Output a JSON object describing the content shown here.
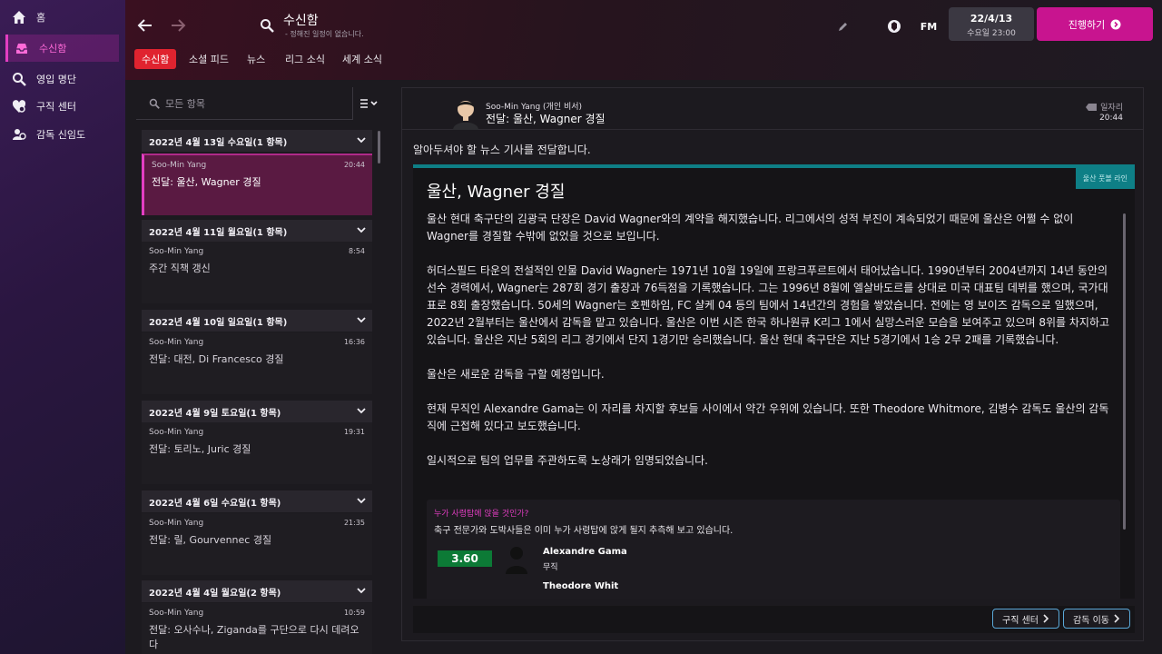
{
  "nav": {
    "items": [
      {
        "label": "홈",
        "icon": "home-icon"
      },
      {
        "label": "수신함",
        "icon": "inbox-icon",
        "active": true
      },
      {
        "label": "영입 명단",
        "icon": "search-icon"
      },
      {
        "label": "구직 센터",
        "icon": "job-centre-icon"
      },
      {
        "label": "감독 신임도",
        "icon": "manager-confidence-icon"
      }
    ]
  },
  "header": {
    "title": "수신함",
    "subtitle": "- 정해진 일정이 없습니다.",
    "date": "22/4/13",
    "date_sub": "수요일 23:00",
    "continue_label": "진행하기",
    "fm_label": "FM",
    "tabs": [
      "수신함",
      "소셜 피드",
      "뉴스",
      "리그 소식",
      "세계 소식"
    ]
  },
  "list": {
    "search_placeholder": "모든 항목",
    "groups": [
      {
        "header": "2022년 4월 13일 수요일(1 항목)",
        "sender": "Soo-Min Yang",
        "time": "20:44",
        "subject": "전달: 울산, Wagner 경질",
        "selected": true
      },
      {
        "header": "2022년 4월 11일 월요일(1 항목)",
        "sender": "Soo-Min Yang",
        "time": "8:54",
        "subject": "주간 직책 갱신"
      },
      {
        "header": "2022년 4월 10일 일요일(1 항목)",
        "sender": "Soo-Min Yang",
        "time": "16:36",
        "subject": "전달: 대전, Di Francesco 경질"
      },
      {
        "header": "2022년 4월 9일 토요일(1 항목)",
        "sender": "Soo-Min Yang",
        "time": "19:31",
        "subject": "전달: 토리노, Juric 경질"
      },
      {
        "header": "2022년 4월 6일 수요일(1 항목)",
        "sender": "Soo-Min Yang",
        "time": "21:35",
        "subject": "전달: 릴, Gourvennec 경질"
      },
      {
        "header": "2022년 4월 4일 월요일(2 항목)",
        "sender": "Soo-Min Yang",
        "time": "10:59",
        "subject": "전달: 오사수나, Ziganda를 구단으로 다시 데려오다"
      }
    ]
  },
  "detail": {
    "sender": "Soo-Min Yang  (개인 비서)",
    "subject": "전달: 울산, Wagner 경질",
    "mark_label": "일자리",
    "time": "20:44",
    "intro": "알아두셔야 할 뉴스 기사를 전달합니다.",
    "card_tag": "울산 풋볼 라인",
    "card_title": "울산, Wagner 경질",
    "paragraphs": [
      "울산 현대 축구단의 김광국 단장은 David Wagner와의 계약을 해지했습니다. 리그에서의 성적 부진이 계속되었기 때문에 울산은 어쩔 수 없이 Wagner를 경질할 수밖에 없었을 것으로 보입니다.",
      "허더스필드 타운의 전설적인 인물 David Wagner는 1971년 10월 19일에 프랑크푸르트에서 태어났습니다. 1990년부터 2004년까지 14년 동안의 선수 경력에서, Wagner는 287회 경기 출장과 76득점을 기록했습니다. 그는 1996년 8월에 엘살바도르를 상대로 미국 대표팀 데뷔를 했으며, 국가대표로 8회 출장했습니다. 50세의 Wagner는 호펜하임, FC 샬케 04 등의 팀에서 14년간의 경험을 쌓았습니다. 전에는 영 보이즈 감독으로 일했으며, 2022년 2월부터는 울산에서 감독을 맡고 있습니다. 울산은 이번 시즌 한국 하나원큐 K리그 1에서 실망스러운 모습을 보여주고 있으며 8위를 차지하고 있습니다. 울산은 지난 5회의 리그 경기에서 단지 1경기만 승리했습니다. 울산 현대 축구단은 지난 5경기에서 1승 2무 2패를 기록했습니다.",
      "울산은 새로운 감독을 구할 예정입니다.",
      "현재 무직인 Alexandre Gama는 이 자리를 차지할 후보들 사이에서 약간 우위에 있습니다.  또한 Theodore Whitmore, 김병수 감독도 울산의 감독직에 근접해 있다고 보도했습니다.",
      "일시적으로 팀의 업무를 주관하도록 노상래가 임명되었습니다."
    ],
    "prediction": {
      "title": "누가 사령탑에 앉을 것인가?",
      "desc": "축구 전문가와 도박사들은 이미 누가 사령탑에 앉게 될지 추측해 보고 있습니다.",
      "odds": "3.60",
      "name": "Alexandre Gama",
      "status": "무직",
      "next": "Theodore Whit"
    },
    "buttons": {
      "job_centre": "구직 센터",
      "move": "감독 이동"
    }
  },
  "colors": {
    "accent": "#c8148f",
    "tab_active": "#e0232f",
    "news_teal": "#0e7f86",
    "odds_green": "#0c7a36"
  }
}
